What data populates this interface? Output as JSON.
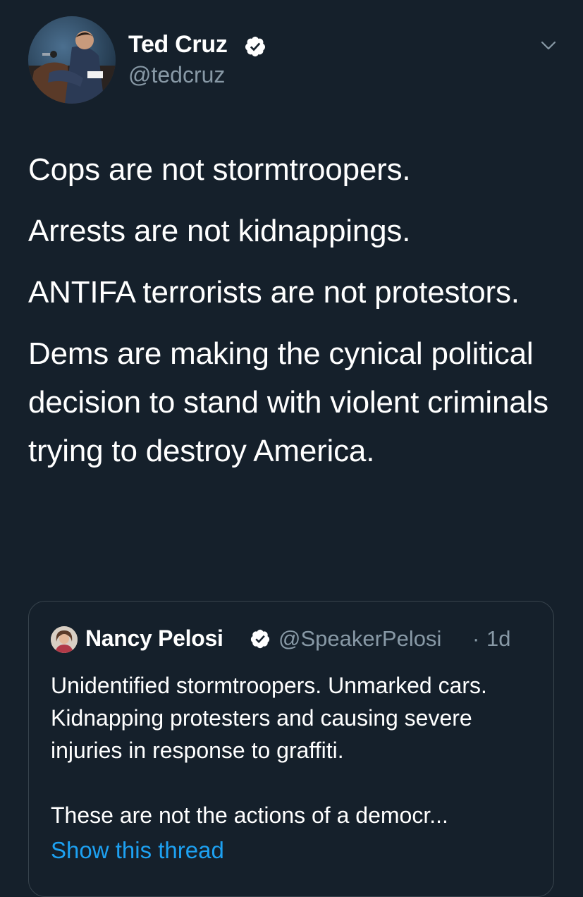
{
  "tweet": {
    "author": {
      "display_name": "Ted Cruz",
      "handle": "@tedcruz",
      "verified": true
    },
    "menu_icon": "chevron-down-icon",
    "text_paragraphs": [
      "Cops are not stormtroopers.",
      "Arrests are not kidnappings.",
      "ANTIFA terrorists are not protestors.",
      "Dems are making the cynical political decision to stand with violent criminals trying to destroy America."
    ]
  },
  "quoted_tweet": {
    "author": {
      "display_name": "Nancy Pelosi",
      "handle": "@SpeakerPelosi",
      "verified": true
    },
    "separator": "·",
    "timestamp": "1d",
    "text_lines": [
      "Unidentified stormtroopers. Unmarked cars. Kidnapping protesters and causing severe injuries in response to graffiti.",
      "These are not the actions of a democr..."
    ],
    "show_thread_label": "Show this thread"
  },
  "colors": {
    "background": "#15202b",
    "text_primary": "#ffffff",
    "text_secondary": "#8899a6",
    "link": "#1da1f2",
    "border": "#38444d"
  }
}
